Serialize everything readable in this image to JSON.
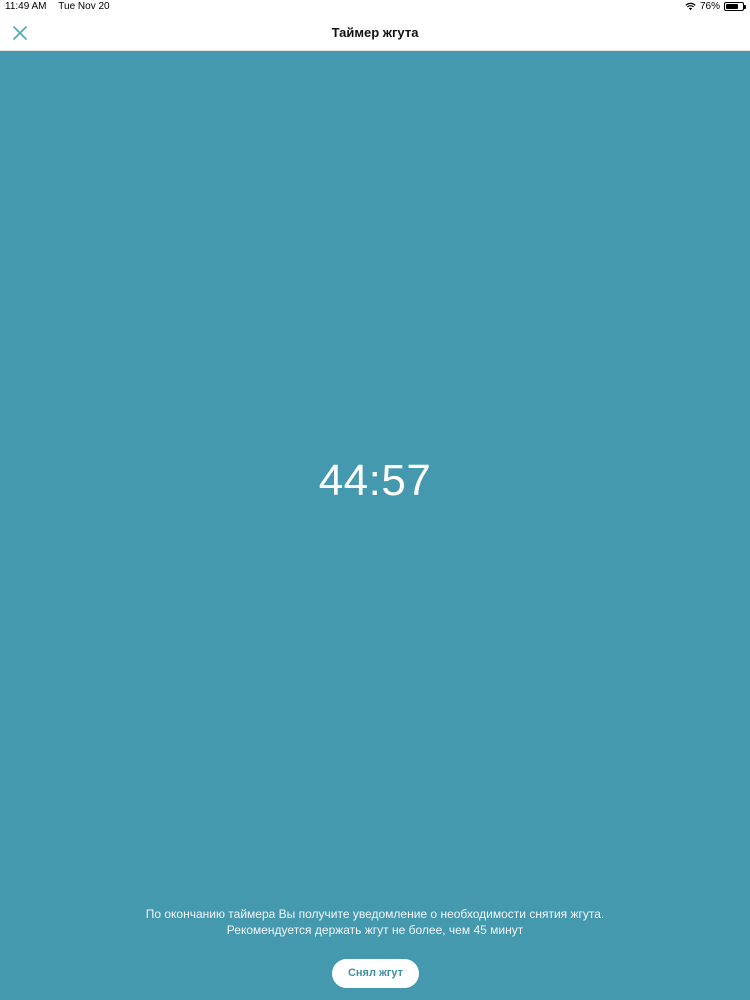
{
  "status_bar": {
    "time": "11:49 AM",
    "date": "Tue Nov 20",
    "battery_percent_text": "76%",
    "battery_level": 0.76,
    "icons": [
      "wifi-icon",
      "battery-icon"
    ]
  },
  "nav": {
    "title": "Таймер жгута",
    "close_icon": "close-icon"
  },
  "timer": {
    "value": "44:57"
  },
  "notice": {
    "line1": "По окончанию таймера Вы получите уведомление о необходимости снятия жгута.",
    "line2": "Рекомендуется держать жгут не более, чем 45 минут"
  },
  "action": {
    "label": "Снял жгут"
  },
  "colors": {
    "background": "#4599ae",
    "accent": "#3f8fa3",
    "close_icon": "#4aa8b8"
  }
}
